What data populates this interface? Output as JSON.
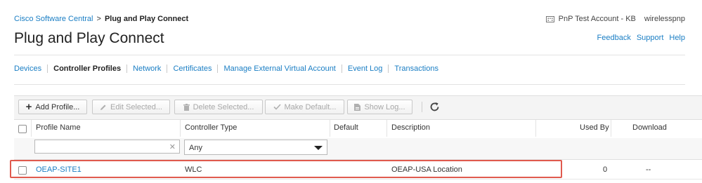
{
  "breadcrumb": {
    "parent": "Cisco Software Central",
    "separator": ">",
    "current": "Plug and Play Connect"
  },
  "account": {
    "name": "PnP Test Account - KB",
    "user": "wirelesspnp"
  },
  "page_title": "Plug and Play Connect",
  "top_links": {
    "feedback": "Feedback",
    "support": "Support",
    "help": "Help"
  },
  "tabs": [
    {
      "label": "Devices"
    },
    {
      "label": "Controller Profiles",
      "active": true
    },
    {
      "label": "Network"
    },
    {
      "label": "Certificates"
    },
    {
      "label": "Manage External Virtual Account"
    },
    {
      "label": "Event Log"
    },
    {
      "label": "Transactions"
    }
  ],
  "toolbar": {
    "add": "Add Profile...",
    "edit": "Edit Selected...",
    "delete": "Delete Selected...",
    "make_default": "Make Default...",
    "show_log": "Show Log..."
  },
  "table": {
    "columns": {
      "profile_name": "Profile Name",
      "controller_type": "Controller Type",
      "default": "Default",
      "description": "Description",
      "used_by": "Used By",
      "download": "Download"
    },
    "filter": {
      "profile_name": "",
      "controller_type": "Any"
    },
    "rows": [
      {
        "profile_name": "OEAP-SITE1",
        "controller_type": "WLC",
        "default": "",
        "description": "OEAP-USA Location",
        "used_by": "0",
        "download": "--"
      }
    ]
  },
  "colors": {
    "link": "#1a7ec4",
    "highlight_border": "#e05a4e"
  }
}
